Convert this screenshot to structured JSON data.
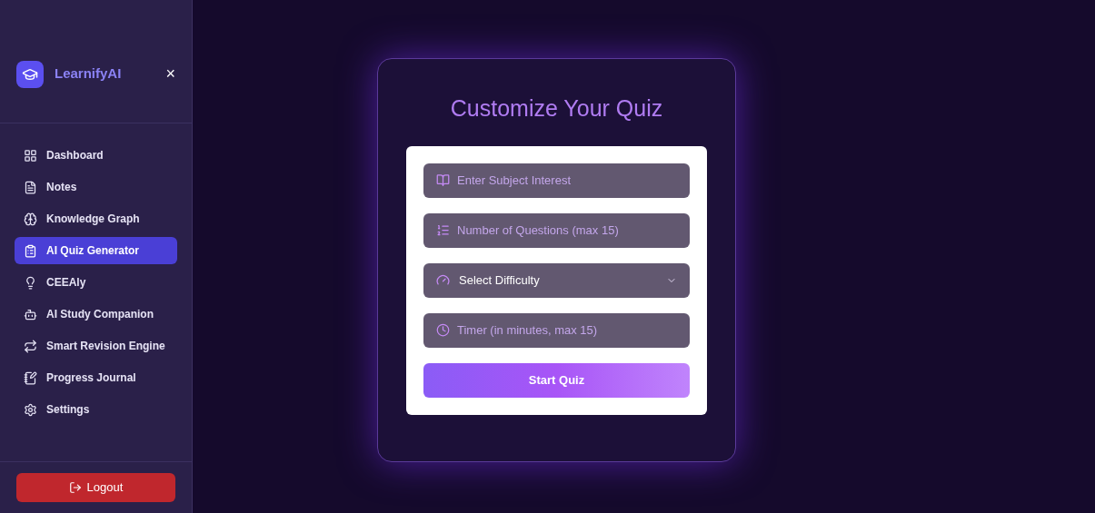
{
  "sidebar": {
    "brand": "LearnifyAI",
    "close": "×",
    "items": [
      {
        "label": "Dashboard",
        "selected": false
      },
      {
        "label": "Notes",
        "selected": false
      },
      {
        "label": "Knowledge Graph",
        "selected": false
      },
      {
        "label": "AI Quiz Generator",
        "selected": true
      },
      {
        "label": "CEEAly",
        "selected": false
      },
      {
        "label": "AI Study Companion",
        "selected": false
      },
      {
        "label": "Smart Revision Engine",
        "selected": false
      },
      {
        "label": "Progress Journal",
        "selected": false
      },
      {
        "label": "Settings",
        "selected": false
      }
    ],
    "logout": "Logout"
  },
  "quiz": {
    "title": "Customize Your Quiz",
    "fields": [
      {
        "kind": "input",
        "placeholder": "Enter Subject Interest"
      },
      {
        "kind": "input",
        "placeholder": "Number of Questions (max 15)"
      },
      {
        "kind": "select",
        "value": "Select Difficulty"
      },
      {
        "kind": "input",
        "placeholder": "Timer (in minutes, max 15)"
      }
    ],
    "submit": "Start Quiz"
  }
}
